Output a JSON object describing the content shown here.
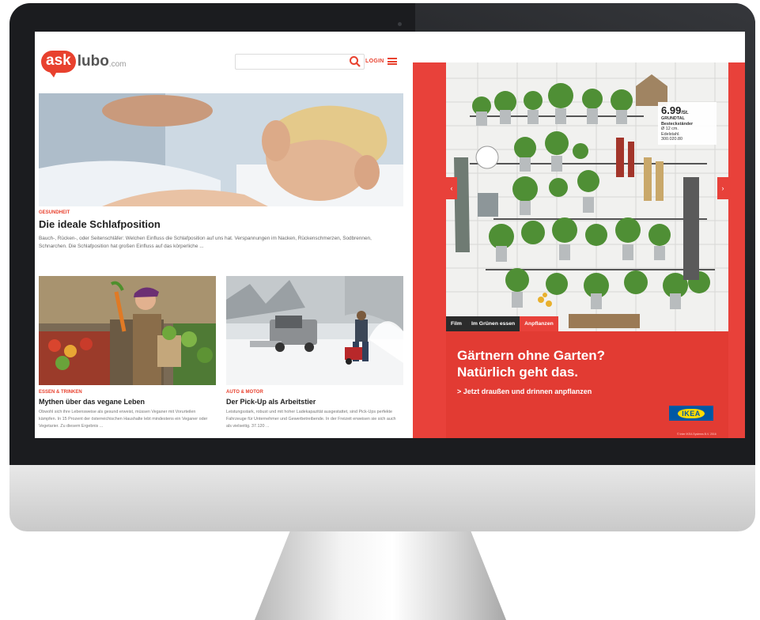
{
  "site": {
    "logo_ask": "ask",
    "logo_lubo": "lubo",
    "logo_domain": ".com",
    "login_label": "LOGIN"
  },
  "hero": {
    "category": "GESUNDHEIT",
    "title": "Die ideale Schlafposition",
    "teaser": "Bauch-, Rücken-, oder Seitenschläfer: Welchen Einfluss die Schlafposition auf uns hat. Verspannungen im Nacken, Rückenschmerzen, Sodbrennen, Schnarchen. Die Schlafposition hat großen Einfluss auf das körperliche ..."
  },
  "cards": [
    {
      "category": "ESSEN & TRINKEN",
      "title": "Mythen über das vegane Leben",
      "teaser": "Obwohl sich ihre Lebensweise als gesund erweist, müssen Veganer mit Vorurteilen kämpfen. In 15 Prozent der österreichischen Haushalte lebt mindestens ein Veganer oder Vegetarier. Zu diesem Ergebnis ..."
    },
    {
      "category": "AUTO & MOTOR",
      "title": "Der Pick-Up als Arbeitstier",
      "teaser": "Leistungsstark, robust und mit hoher Ladekapazität ausgestattet, sind Pick-Ups perfekte Fahrzeuge für Unternehmer und Gewerbetreibende. In der Freizeit erweisen sie sich auch als vielseitig. 37.120 ..."
    }
  ],
  "ad": {
    "price": "6.99",
    "price_unit": "/St.",
    "product_name": "GRUNDTAL",
    "product_desc": "Besteckständer",
    "product_size": "Ø 12 cm.",
    "product_material": "Edelstahl.",
    "product_number": "300.020.80",
    "tabs": [
      "Film",
      "Im Grünen essen",
      "Anpflanzen"
    ],
    "headline_1": "Gärtnern ohne Garten?",
    "headline_2": "Natürlich geht das.",
    "link": "> Jetzt draußen und drinnen anpflanzen",
    "brand": "IKEA",
    "fineprint": "© Inter IKEA Systems B.V. 2016",
    "accent_color": "#e8413a"
  }
}
